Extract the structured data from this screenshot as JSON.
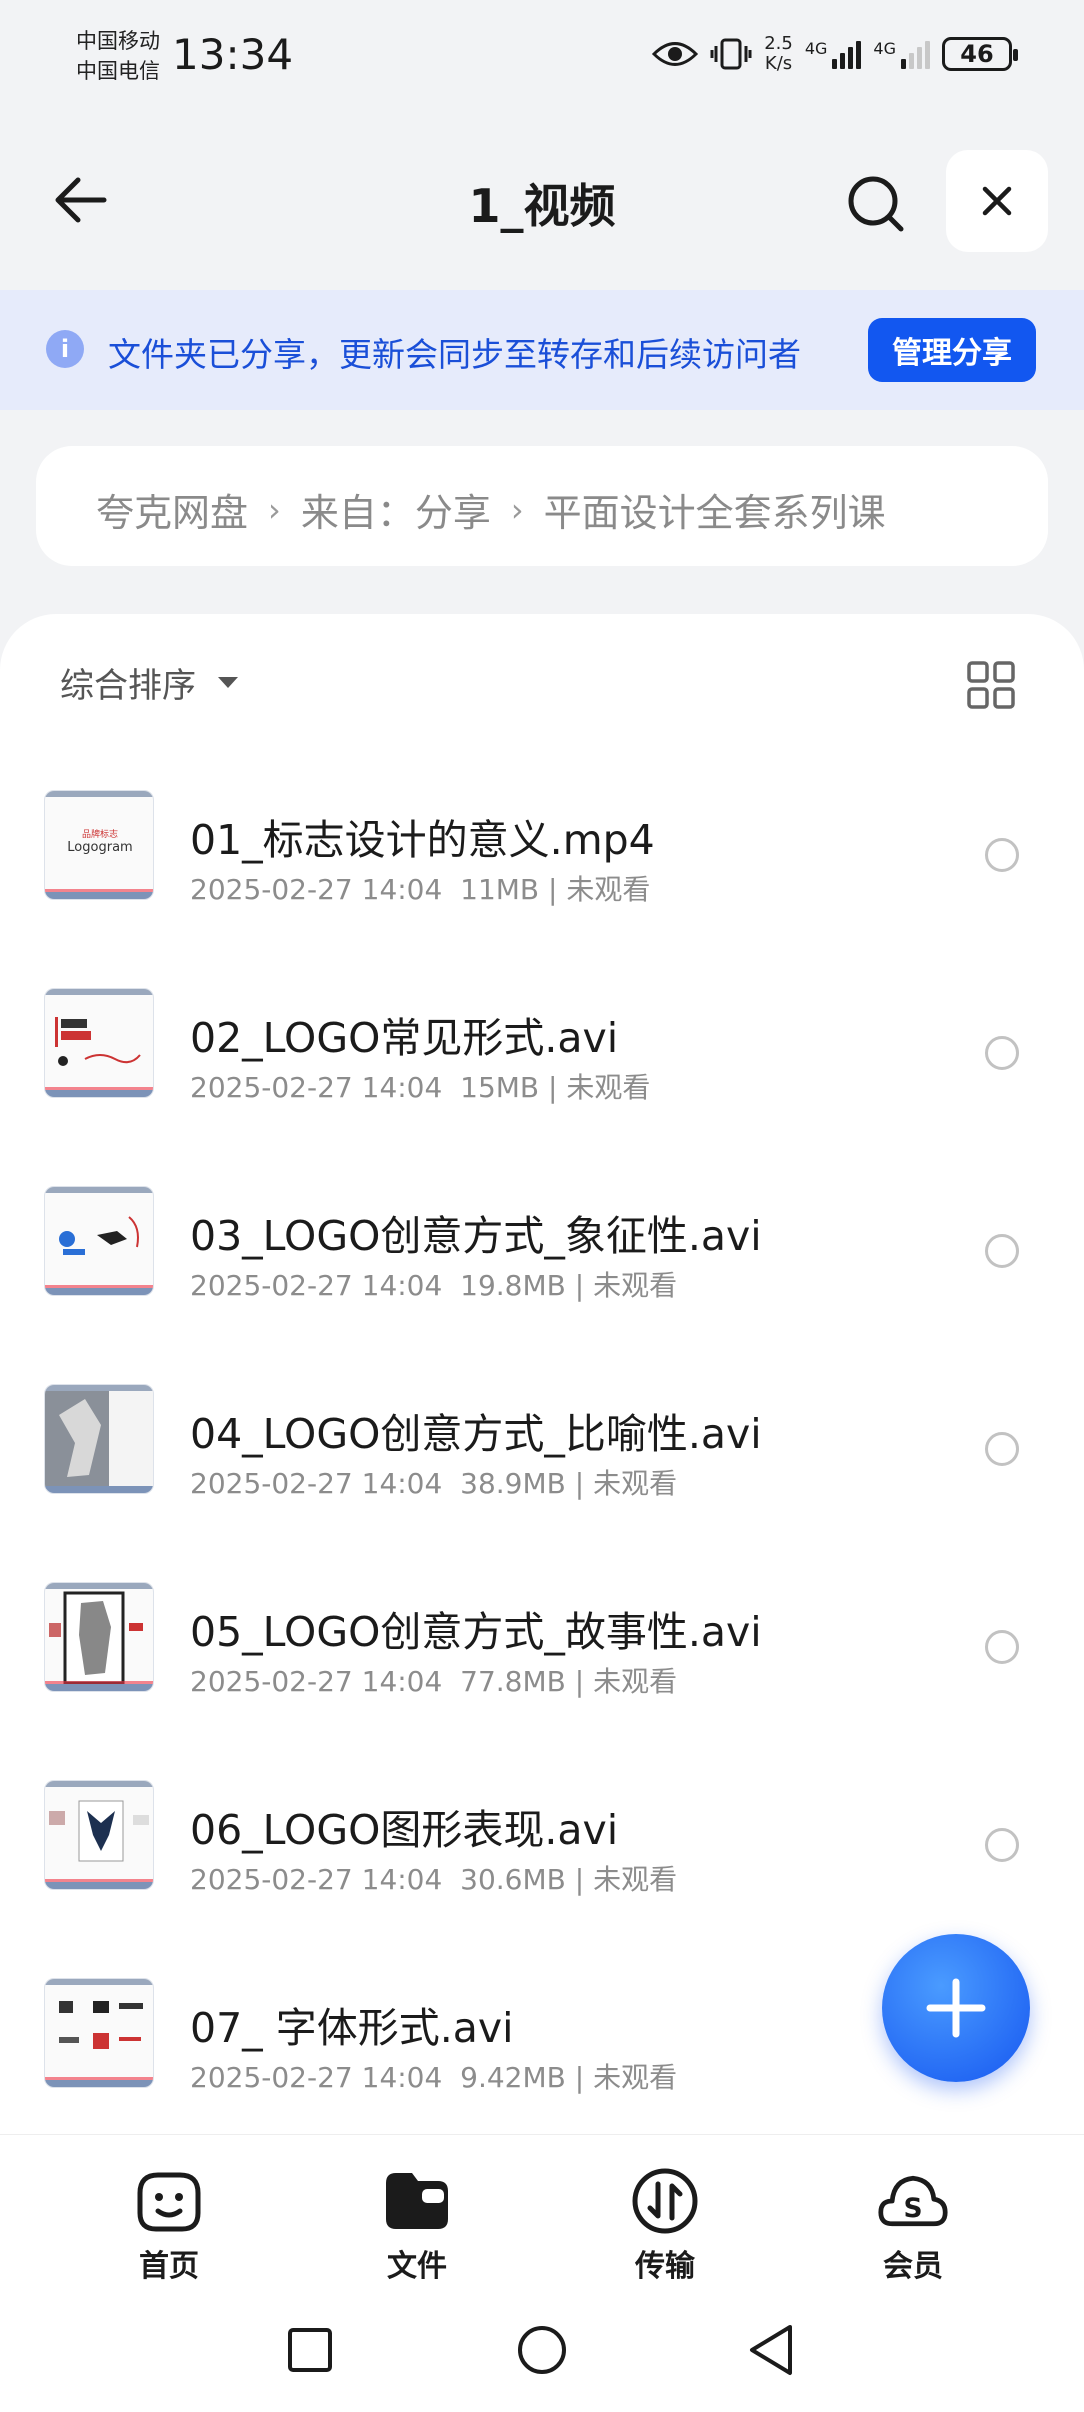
{
  "status_bar": {
    "carrier_1": "中国移动",
    "carrier_2": "中国电信",
    "time": "13:34",
    "net_speed_value": "2.5",
    "net_speed_unit": "K/s",
    "signal_1_label": "4G",
    "signal_2_label": "4G",
    "battery": "46",
    "icons": [
      "eye-icon",
      "vibrate-icon"
    ]
  },
  "header": {
    "title": "1_视频",
    "icons": [
      "back-arrow-icon",
      "search-icon",
      "close-icon"
    ]
  },
  "banner": {
    "text": "文件夹已分享，更新会同步至转存和后续访问者",
    "button": "管理分享",
    "accent": "#1257f0"
  },
  "breadcrumb": {
    "items": [
      "夸克网盘",
      "来自：分享",
      "平面设计全套系列课"
    ]
  },
  "toolbar": {
    "sort_label": "综合排序"
  },
  "files": [
    {
      "name": "01_标志设计的意义.mp4",
      "date": "2025-02-27 14:04",
      "size": "11MB",
      "status": "未观看"
    },
    {
      "name": "02_LOGO常见形式.avi",
      "date": "2025-02-27 14:04",
      "size": "15MB",
      "status": "未观看"
    },
    {
      "name": "03_LOGO创意方式_象征性.avi",
      "date": "2025-02-27 14:04",
      "size": "19.8MB",
      "status": "未观看"
    },
    {
      "name": "04_LOGO创意方式_比喻性.avi",
      "date": "2025-02-27 14:04",
      "size": "38.9MB",
      "status": "未观看"
    },
    {
      "name": "05_LOGO创意方式_故事性.avi",
      "date": "2025-02-27 14:04",
      "size": "77.8MB",
      "status": "未观看"
    },
    {
      "name": "06_LOGO图形表现.avi",
      "date": "2025-02-27 14:04",
      "size": "30.6MB",
      "status": "未观看"
    },
    {
      "name": "07_ 字体形式.avi",
      "date": "2025-02-27 14:04",
      "size": "9.42MB",
      "status": "未观看"
    }
  ],
  "bottom_nav": {
    "items": [
      "首页",
      "文件",
      "传输",
      "会员"
    ]
  }
}
